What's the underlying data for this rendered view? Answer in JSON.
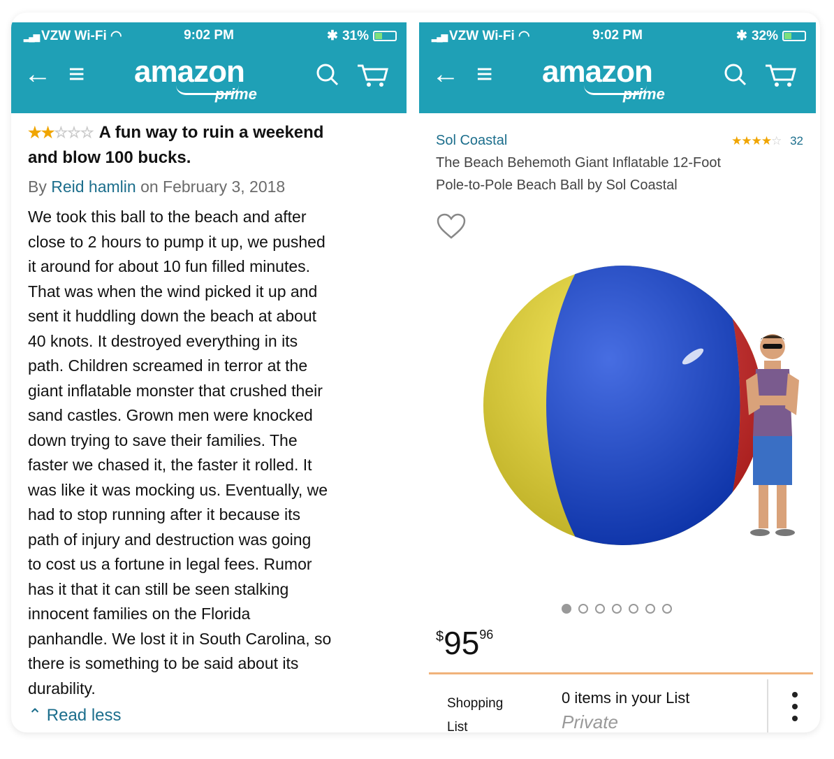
{
  "left": {
    "status": {
      "carrier": "VZW Wi-Fi",
      "time": "9:02 PM",
      "battery": "31%"
    },
    "logo": {
      "word": "amazon",
      "prime": "prime"
    },
    "review": {
      "stars": {
        "filled": "★★",
        "empty": "☆☆☆"
      },
      "title_line1": "A fun way to ruin a weekend",
      "title_line2": "and blow 100 bucks.",
      "by_prefix": "By",
      "author": "Reid hamlin",
      "date": "on February 3, 2018",
      "body": [
        "We took this ball to the beach and after",
        "close to 2 hours to pump it up, we pushed",
        "it around for about 10 fun filled minutes.",
        "That was when the wind picked it up and",
        "sent it huddling down the beach at about",
        "40 knots. It destroyed everything in its",
        "path. Children screamed in terror at the",
        "giant inflatable monster that crushed their",
        "sand castles. Grown men were knocked",
        "down trying to save their families. The",
        "faster we chased it, the faster it rolled. It",
        "was like it was mocking us. Eventually, we",
        "had to stop running after it because its",
        "path of injury and destruction was going",
        "to cost us a fortune in legal fees. Rumor",
        "has it that it can still be seen stalking",
        "innocent families on the Florida",
        "panhandle. We lost it in South Carolina, so",
        "there is something to be said about its",
        "durability."
      ],
      "read_less": "Read less"
    }
  },
  "right": {
    "status": {
      "carrier": "VZW Wi-Fi",
      "time": "9:02 PM",
      "battery": "32%"
    },
    "logo": {
      "word": "amazon",
      "prime": "prime"
    },
    "product": {
      "brand": "Sol Coastal",
      "stars": {
        "filled": "★★★★",
        "empty": "☆"
      },
      "rating_count": "32",
      "title_line1": "The Beach Behemoth Giant Inflatable 12-Foot",
      "title_line2": "Pole-to-Pole Beach Ball by Sol Coastal",
      "image_count": 7,
      "price": {
        "currency": "$",
        "whole": "95",
        "fraction": "96"
      },
      "list": {
        "label_line1": "Shopping",
        "label_line2": "List",
        "count": "0 items in your List",
        "privacy": "Private"
      }
    }
  },
  "colors": {
    "header": "#1fa0b6",
    "link": "#1c6e8c",
    "star": "#f0a500",
    "divider": "#f0b27a"
  },
  "icons": [
    "back-arrow-icon",
    "menu-icon",
    "search-icon",
    "cart-icon",
    "heart-icon",
    "more-vertical-icon",
    "chevron-up-icon"
  ]
}
